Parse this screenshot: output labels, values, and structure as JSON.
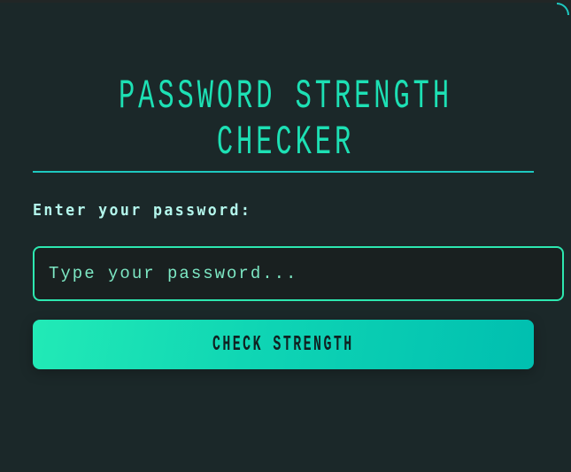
{
  "header": {
    "title_line1": "PASSWORD STRENGTH",
    "title_line2": "CHECKER"
  },
  "form": {
    "label": "Enter your password:",
    "password_value": "",
    "password_placeholder": "Type your password...",
    "submit_label": "CHECK STRENGTH"
  },
  "colors": {
    "accent": "#1de0b4",
    "background": "#1b2829",
    "button_start": "#22eab6",
    "button_end": "#00bfb0"
  }
}
